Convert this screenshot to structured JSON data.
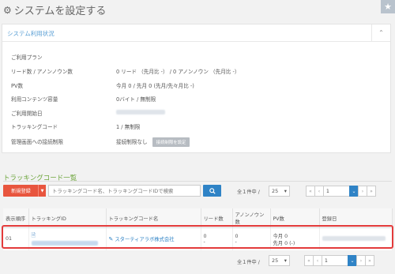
{
  "page": {
    "title": "システムを設定する",
    "gear_icon": "gear-icon",
    "star_icon": "star-icon"
  },
  "usage_panel": {
    "title": "システム利用状況",
    "rows": [
      {
        "label": "ご利用プラン",
        "value": ""
      },
      {
        "label": "リード数 / アノンノウン数",
        "value": "0 リード （先月比 -） / 0 アノンノウン （先月比 -）"
      },
      {
        "label": "PV数",
        "value": "今月 0 / 先月 0 (先月/先々月比 -)"
      },
      {
        "label": "利用コンテンツ容量",
        "value": "0バイト / 無制限"
      },
      {
        "label": "ご利用開始日",
        "value": ""
      },
      {
        "label": "トラッキングコード",
        "value": "1 / 無制限"
      },
      {
        "label": "管理画面への接続制限",
        "value": "接続制限なし"
      }
    ],
    "restrict_button": "接続制限を設定"
  },
  "tracking": {
    "section_title": "トラッキングコード一覧",
    "new_button": "新規登録",
    "search_placeholder": "トラッキングコード名、トラッキングコードIDで検索",
    "count_text": "全１件中 /",
    "per_page": "25",
    "current_page": "1",
    "columns": [
      "表示順序",
      "トラッキングID",
      "トラッキングコード名",
      "リード数",
      "アノンノウン数",
      "PV数",
      "登録日"
    ],
    "rows": [
      {
        "order": "01",
        "name": "スターティアラボ株式会社",
        "leads": "0",
        "leads_sub": "-",
        "anon": "0",
        "anon_sub": "-",
        "pv_month": "今月 0",
        "pv_prev": "先月 0 (-)"
      }
    ]
  }
}
